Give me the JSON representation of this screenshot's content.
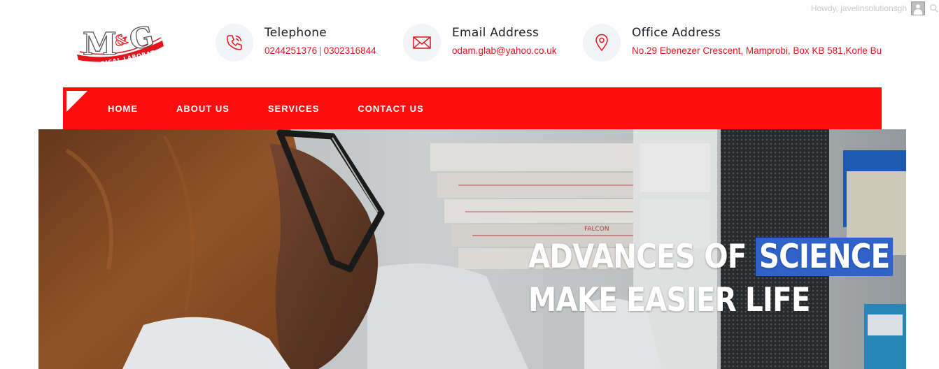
{
  "admin_bar": {
    "greeting": "Howdy, javelinsolutionsgh",
    "avatar_icon": "user-avatar-icon",
    "search_icon": "search-icon"
  },
  "logo": {
    "monogram": "M&G",
    "subtitle": "MEDICAL LABORATORY",
    "color": "#e3141b"
  },
  "contacts": [
    {
      "label": "Telephone",
      "icon": "phone-icon",
      "values": [
        "0244251376",
        "0302316844"
      ],
      "separator": "|"
    },
    {
      "label": "Email Address",
      "icon": "envelope-icon",
      "value": "odam.glab@yahoo.co.uk"
    },
    {
      "label": "Office Address",
      "icon": "map-pin-icon",
      "value": "No.29 Ebenezer Crescent, Mamprobi, Box KB 581,Korle Bu"
    }
  ],
  "nav": {
    "items": [
      "HOME",
      "ABOUT US",
      "SERVICES",
      "CONTACT US"
    ],
    "background": "#ff0d0d"
  },
  "hero": {
    "line1_prefix": "ADVANCES OF",
    "line1_highlight": "SCIENCE",
    "line2": "MAKE EASIER LIFE",
    "highlight_color": "#2f63c9"
  },
  "colors": {
    "accent_red": "#e3141b",
    "nav_red": "#ff0d0d",
    "heading_text": "#1d1d2b"
  }
}
